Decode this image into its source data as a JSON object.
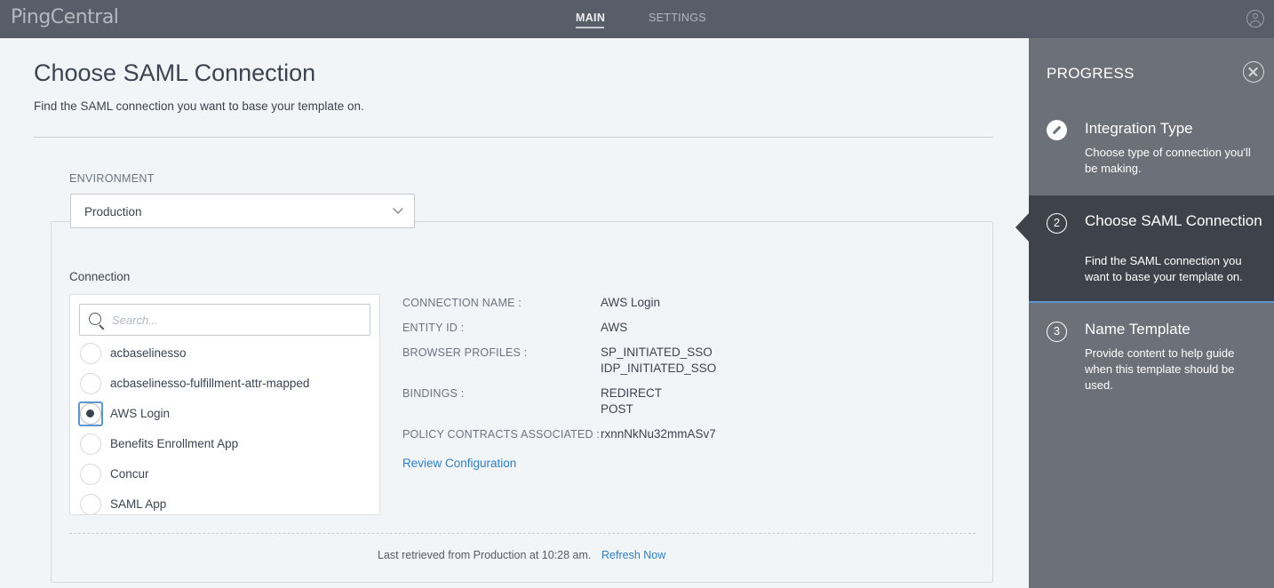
{
  "topbar": {
    "logo": "PingCentral",
    "tabs": [
      {
        "label": "MAIN",
        "active": true
      },
      {
        "label": "SETTINGS",
        "active": false
      }
    ]
  },
  "main": {
    "title": "Choose SAML Connection",
    "subtitle": "Find the SAML connection you want to base your template on.",
    "environment_label": "ENVIRONMENT",
    "environment_value": "Production",
    "connection_label": "Connection",
    "search_placeholder": "Search...",
    "connections": [
      {
        "label": "acbaselinesso",
        "selected": false
      },
      {
        "label": "acbaselinesso-fulfillment-attr-mapped",
        "selected": false
      },
      {
        "label": "AWS Login",
        "selected": true
      },
      {
        "label": "Benefits Enrollment App",
        "selected": false
      },
      {
        "label": "Concur",
        "selected": false
      },
      {
        "label": "SAML App",
        "selected": false
      }
    ],
    "details": {
      "connection_name_key": "CONNECTION NAME :",
      "connection_name_val": "AWS Login",
      "entity_id_key": "ENTITY ID :",
      "entity_id_val": "AWS",
      "browser_profiles_key": "BROWSER PROFILES :",
      "browser_profiles_val1": "SP_INITIATED_SSO",
      "browser_profiles_val2": "IDP_INITIATED_SSO",
      "bindings_key": "BINDINGS :",
      "bindings_val1": "REDIRECT",
      "bindings_val2": "POST",
      "policy_key": "POLICY CONTRACTS ASSOCIATED :",
      "policy_val": "rxnnNkNu32mmASv7",
      "review_link": "Review Configuration"
    },
    "retrieved_text": "Last retrieved from Production at 10:28 am.",
    "refresh_link": "Refresh Now"
  },
  "progress": {
    "title": "PROGRESS",
    "steps": [
      {
        "number": "",
        "title": "Integration Type",
        "desc": "Choose type of connection you'll be making.",
        "state": "done"
      },
      {
        "number": "2",
        "title": "Choose SAML Connection",
        "desc": "Find the SAML connection you want to base your template on.",
        "state": "active"
      },
      {
        "number": "3",
        "title": "Name Template",
        "desc": "Provide content to help guide when this template should be used.",
        "state": "pending"
      }
    ]
  },
  "colors": {
    "topbar": "#575e67",
    "sidebar": "#6b7079",
    "active_step": "#3e434b",
    "link": "#2f7fc1",
    "focus": "#5e96d4"
  }
}
